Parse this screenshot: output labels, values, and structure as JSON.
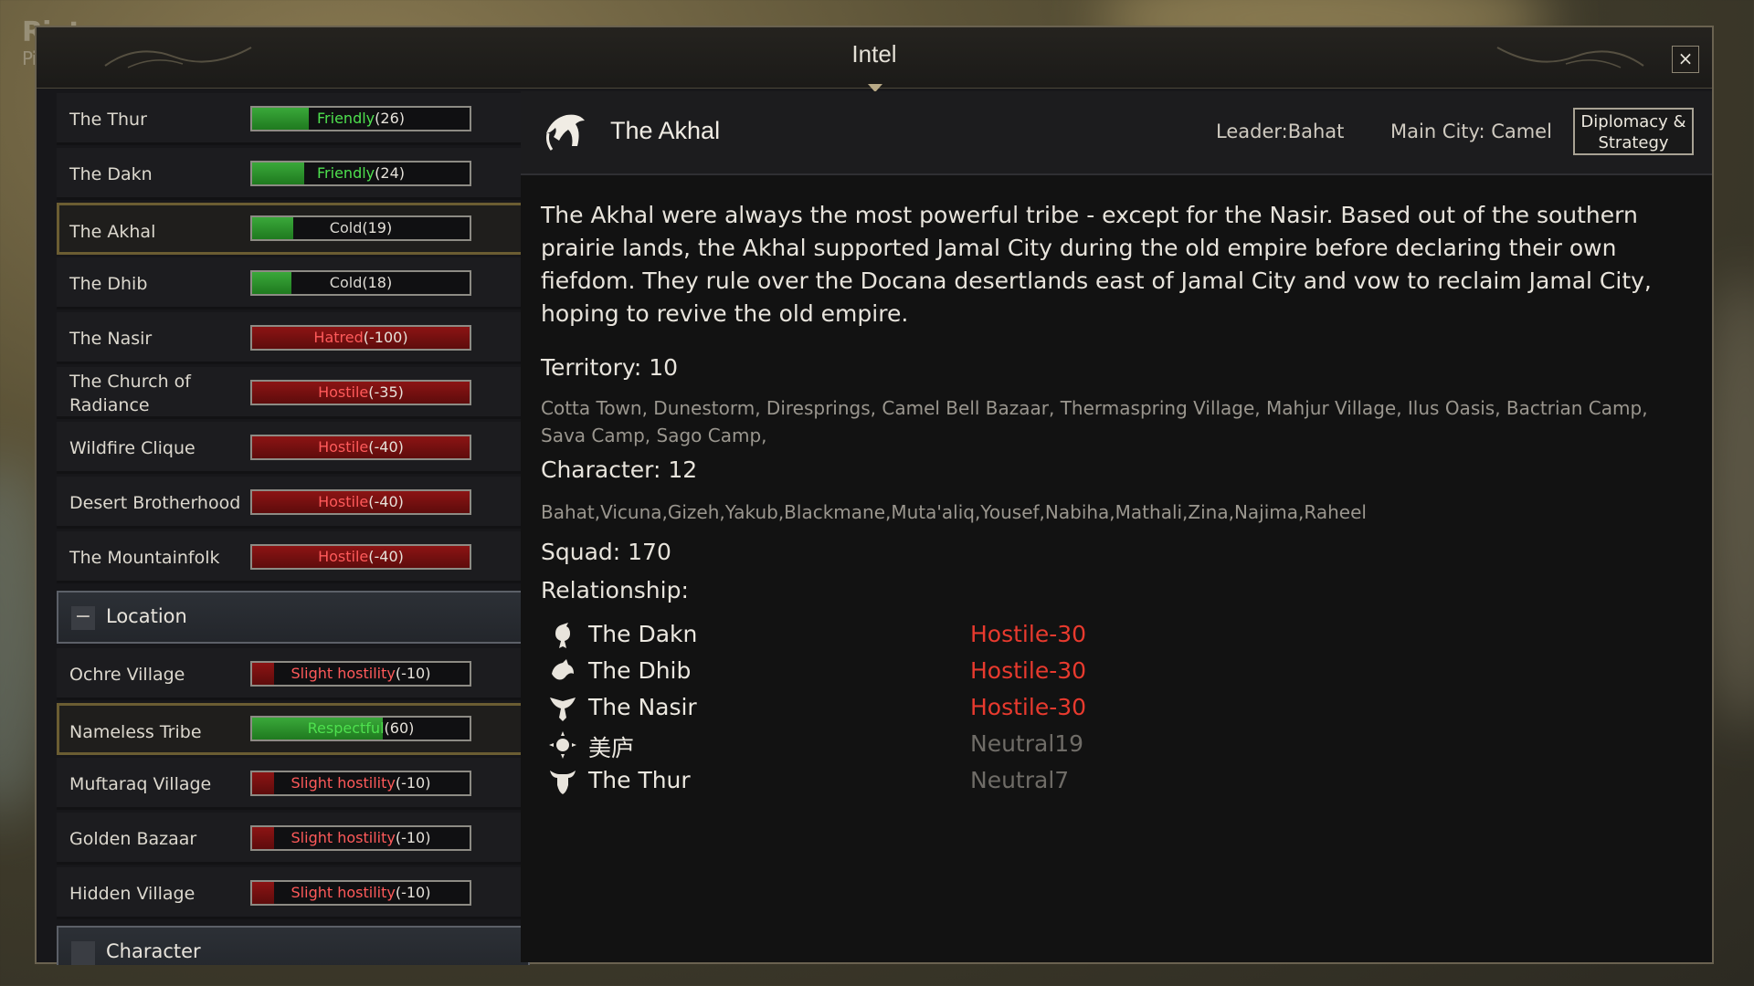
{
  "watermark": {
    "line1": "Riot",
    "line2": "Pixels"
  },
  "window": {
    "title": "Intel",
    "close_label": "×"
  },
  "sidebar": {
    "factions": [
      {
        "name": "The Thur",
        "level": "Friendly",
        "value": "(26)",
        "tone": "pos",
        "fill_fraction": 0.26
      },
      {
        "name": "The Dakn",
        "level": "Friendly",
        "value": "(24)",
        "tone": "pos",
        "fill_fraction": 0.24
      },
      {
        "name": "The Akhal",
        "level": "Cold",
        "value": "(19)",
        "tone": "cold",
        "fill_fraction": 0.19,
        "selected": true
      },
      {
        "name": "The Dhib",
        "level": "Cold",
        "value": "(18)",
        "tone": "cold",
        "fill_fraction": 0.18
      },
      {
        "name": "The Nasir",
        "level": "Hatred",
        "value": "(-100)",
        "tone": "neg",
        "fill_fraction": 1.0
      },
      {
        "name": "The Church of Radiance",
        "level": "Hostile",
        "value": "(-35)",
        "tone": "neg",
        "fill_fraction": 1.0
      },
      {
        "name": "Wildfire Clique",
        "level": "Hostile",
        "value": "(-40)",
        "tone": "neg",
        "fill_fraction": 1.0
      },
      {
        "name": "Desert Brotherhood",
        "level": "Hostile",
        "value": "(-40)",
        "tone": "neg",
        "fill_fraction": 1.0
      },
      {
        "name": "The Mountainfolk",
        "level": "Hostile",
        "value": "(-40)",
        "tone": "neg",
        "fill_fraction": 1.0
      }
    ],
    "location_section": {
      "minus": "−",
      "title": "Location"
    },
    "locations": [
      {
        "name": "Ochre Village",
        "level": "Slight hostility",
        "value": "(-10)",
        "tone": "neg",
        "fill_fraction": 0.1
      },
      {
        "name": "Nameless Tribe",
        "level": "Respectful",
        "value": "(60)",
        "tone": "pos",
        "fill_fraction": 0.6,
        "selected": true
      },
      {
        "name": "Muftaraq Village",
        "level": "Slight hostility",
        "value": "(-10)",
        "tone": "neg",
        "fill_fraction": 0.1
      },
      {
        "name": "Golden Bazaar",
        "level": "Slight hostility",
        "value": "(-10)",
        "tone": "neg",
        "fill_fraction": 0.1
      },
      {
        "name": "Hidden Village",
        "level": "Slight hostility",
        "value": "(-10)",
        "tone": "neg",
        "fill_fraction": 0.1
      }
    ],
    "character_section": {
      "title": "Character"
    }
  },
  "detail": {
    "name": "The Akhal",
    "leader": "Leader:Bahat",
    "main_city": "Main City: Camel",
    "diplomacy_button": "Diplomacy & Strategy",
    "description": "The Akhal were always the most powerful tribe - except for the Nasir. Based out of the southern prairie lands, the Akhal supported Jamal City during the old empire before declaring their own fiefdom. They rule over the Docana desertlands east of Jamal City and vow to reclaim Jamal City, hoping to revive the old empire.",
    "territory_label": "Territory: 10",
    "territory_list": "Cotta Town, Dunestorm, Diresprings, Camel Bell Bazaar, Thermaspring Village, Mahjur Village, Ilus Oasis, Bactrian Camp, Sava Camp, Sago Camp,",
    "character_label": "Character: 12",
    "character_list": "Bahat,Vicuna,Gizeh,Yakub,Blackmane,Muta'aliq,Yousef,Nabiha,Mathali,Zina,Najima,Raheel",
    "squad_label": "Squad: 170",
    "relationship_label": "Relationship:",
    "relationships": [
      {
        "name": "The Dakn",
        "status": "Hostile-30",
        "tone": "hostile",
        "icon": "scorpion-emblem-icon"
      },
      {
        "name": "The Dhib",
        "status": "Hostile-30",
        "tone": "hostile",
        "icon": "wolf-emblem-icon"
      },
      {
        "name": "The Nasir",
        "status": "Hostile-30",
        "tone": "hostile",
        "icon": "eagle-emblem-icon"
      },
      {
        "name": "美庐",
        "status": "Neutral19",
        "tone": "neutral",
        "icon": "sun-emblem-icon"
      },
      {
        "name": "The Thur",
        "status": "Neutral7",
        "tone": "neutral",
        "icon": "bull-emblem-icon"
      }
    ]
  },
  "colors": {
    "hostile": "#e83a2e",
    "neutral": "#6f6c67",
    "friendly_bar": "#2e9a2e",
    "hostile_bar": "#7a1010",
    "selected_border": "#6b5d32"
  }
}
